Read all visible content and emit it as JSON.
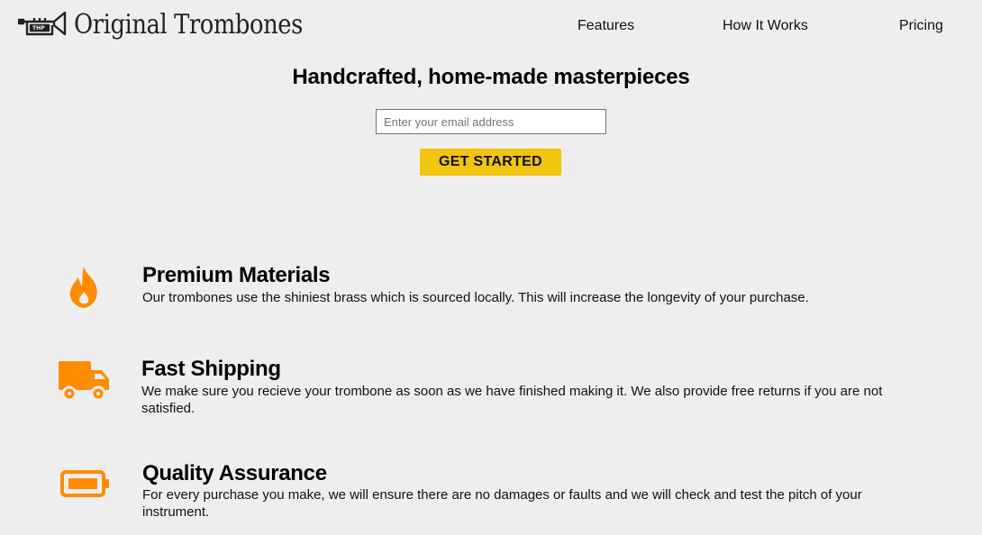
{
  "header": {
    "logo_text": "Original Trombones",
    "logo_icon": "trombone-icon",
    "nav": [
      {
        "label": "Features"
      },
      {
        "label": "How It Works"
      },
      {
        "label": "Pricing"
      }
    ]
  },
  "hero": {
    "title": "Handcrafted, home-made masterpieces",
    "email_placeholder": "Enter your email address",
    "email_value": "",
    "cta_label": "GET STARTED"
  },
  "features": [
    {
      "icon": "fire-icon",
      "title": "Premium Materials",
      "description": "Our trombones use the shiniest brass which is sourced locally. This will increase the longevity of your purchase."
    },
    {
      "icon": "truck-icon",
      "title": "Fast Shipping",
      "description": "We make sure you recieve your trombone as soon as we have finished making it. We also provide free returns if you are not satisfied."
    },
    {
      "icon": "battery-icon",
      "title": "Quality Assurance",
      "description": "For every purchase you make, we will ensure there are no damages or faults and we will check and test the pitch of your instrument."
    }
  ],
  "colors": {
    "background": "#eeeeee",
    "accent_button": "#f1c40f",
    "icon_orange": "#ff8c00",
    "text": "#000000"
  }
}
